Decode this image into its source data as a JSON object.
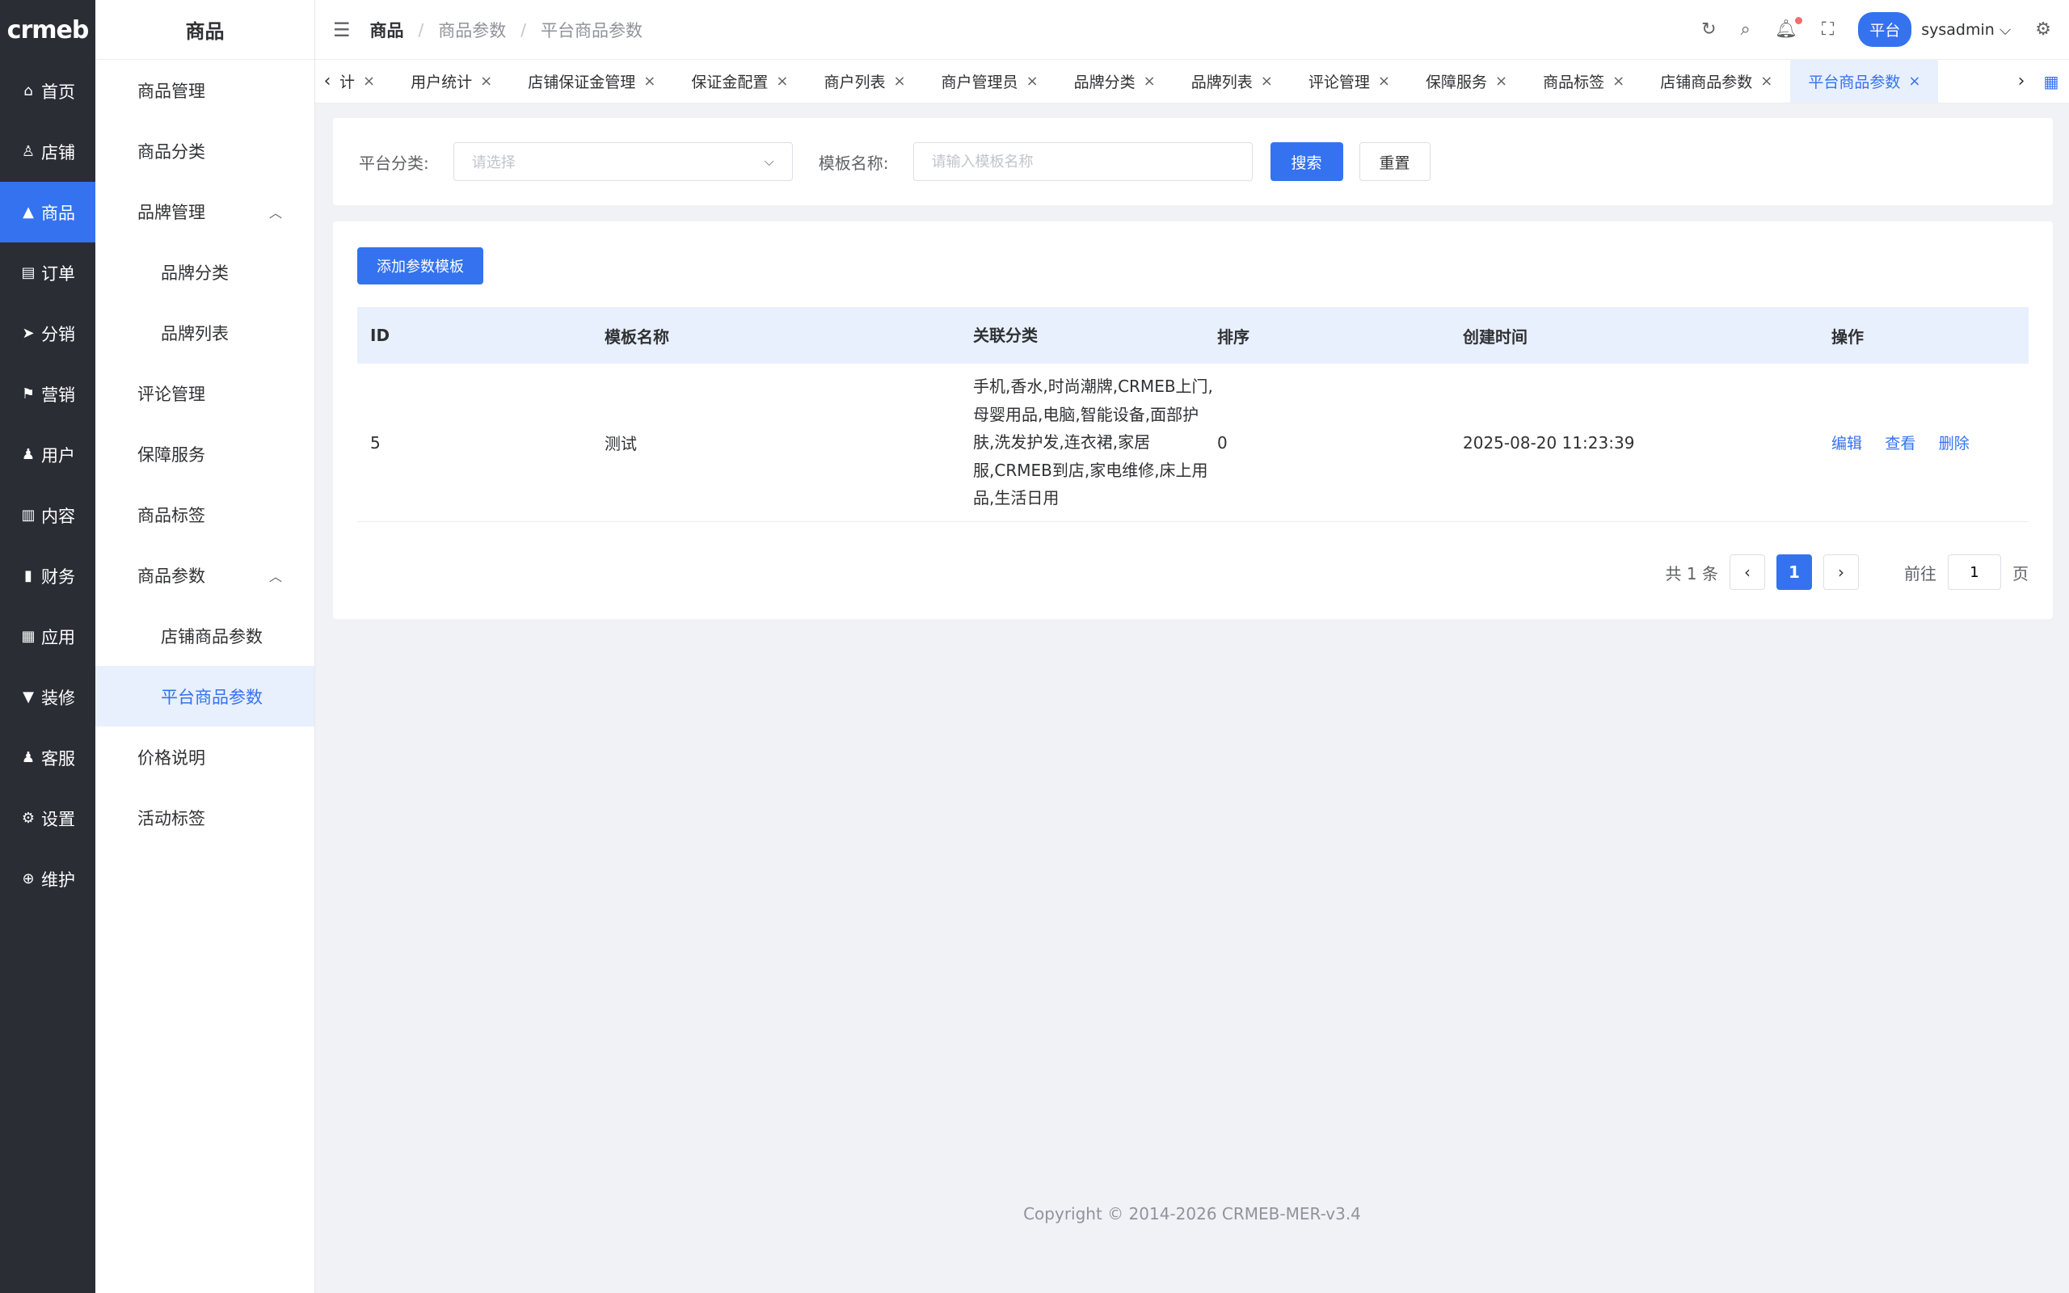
{
  "rail": {
    "logo": "crmeb",
    "items": [
      {
        "label": "首页",
        "icon": "home-icon",
        "glyph": "⌂"
      },
      {
        "label": "店铺",
        "icon": "shop-icon",
        "glyph": "♙"
      },
      {
        "label": "商品",
        "icon": "bag-icon",
        "glyph": "▲"
      },
      {
        "label": "订单",
        "icon": "clipboard-icon",
        "glyph": "▤"
      },
      {
        "label": "分销",
        "icon": "send-icon",
        "glyph": "➤"
      },
      {
        "label": "营销",
        "icon": "flag-icon",
        "glyph": "⚑"
      },
      {
        "label": "用户",
        "icon": "user-icon",
        "glyph": "♟"
      },
      {
        "label": "内容",
        "icon": "book-icon",
        "glyph": "▥"
      },
      {
        "label": "财务",
        "icon": "bar-chart-icon",
        "glyph": "▮"
      },
      {
        "label": "应用",
        "icon": "grid-icon",
        "glyph": "▦"
      },
      {
        "label": "装修",
        "icon": "brush-icon",
        "glyph": "▼"
      },
      {
        "label": "客服",
        "icon": "support-icon",
        "glyph": "♟"
      },
      {
        "label": "设置",
        "icon": "gear-icon",
        "glyph": "⚙"
      },
      {
        "label": "维护",
        "icon": "plus-circle-icon",
        "glyph": "⊕"
      }
    ]
  },
  "submenu": {
    "title": "商品",
    "items": [
      {
        "label": "商品管理"
      },
      {
        "label": "商品分类"
      },
      {
        "label": "品牌管理"
      },
      {
        "label": "品牌分类"
      },
      {
        "label": "品牌列表"
      },
      {
        "label": "评论管理"
      },
      {
        "label": "保障服务"
      },
      {
        "label": "商品标签"
      },
      {
        "label": "商品参数"
      },
      {
        "label": "店铺商品参数"
      },
      {
        "label": "平台商品参数"
      },
      {
        "label": "价格说明"
      },
      {
        "label": "活动标签"
      }
    ]
  },
  "header": {
    "breadcrumb": [
      "商品",
      "商品参数",
      "平台商品参数"
    ],
    "platform_tag": "平台",
    "username": "sysadmin"
  },
  "tabs": [
    "计",
    "用户统计",
    "店铺保证金管理",
    "保证金配置",
    "商户列表",
    "商户管理员",
    "品牌分类",
    "品牌列表",
    "评论管理",
    "保障服务",
    "商品标签",
    "店铺商品参数",
    "平台商品参数"
  ],
  "search": {
    "category_label": "平台分类:",
    "category_placeholder": "请选择",
    "name_label": "模板名称:",
    "name_placeholder": "请输入模板名称",
    "search_button": "搜索",
    "reset_button": "重置"
  },
  "table": {
    "add_button": "添加参数模板",
    "columns": [
      "ID",
      "模板名称",
      "关联分类",
      "排序",
      "创建时间",
      "操作"
    ],
    "rows": [
      {
        "id": "5",
        "name": "测试",
        "categories": "手机,香水,时尚潮牌,CRMEB上门,母婴用品,电脑,智能设备,面部护肤,洗发护发,连衣裙,家居服,CRMEB到店,家电维修,床上用品,生活日用",
        "sort": "0",
        "created": "2025-08-20 11:23:39",
        "actions": [
          "编辑",
          "查看",
          "删除"
        ]
      }
    ]
  },
  "pagination": {
    "total_text": "共 1 条",
    "current_page": "1",
    "goto_prefix": "前往",
    "goto_value": "1",
    "goto_suffix": "页"
  },
  "footer": "Copyright © 2014-2026 CRMEB-MER-v3.4",
  "colors": {
    "accent": "#3472f0",
    "rail_bg": "#2b2d35",
    "page_bg": "#f0f2f5",
    "table_header_bg": "#e8f0fe"
  }
}
